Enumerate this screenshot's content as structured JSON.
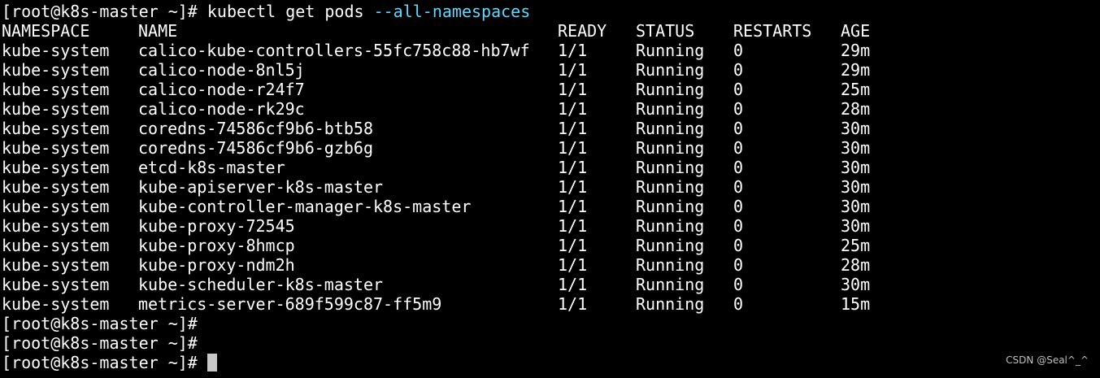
{
  "prompt": "[root@k8s-master ~]#",
  "command": {
    "text": "kubectl get pods",
    "arg": "--all-namespaces"
  },
  "headers": {
    "namespace": "NAMESPACE",
    "name": "NAME",
    "ready": "READY",
    "status": "STATUS",
    "restarts": "RESTARTS",
    "age": "AGE"
  },
  "rows": [
    {
      "namespace": "kube-system",
      "name": "calico-kube-controllers-55fc758c88-hb7wf",
      "ready": "1/1",
      "status": "Running",
      "restarts": "0",
      "age": "29m"
    },
    {
      "namespace": "kube-system",
      "name": "calico-node-8nl5j",
      "ready": "1/1",
      "status": "Running",
      "restarts": "0",
      "age": "29m"
    },
    {
      "namespace": "kube-system",
      "name": "calico-node-r24f7",
      "ready": "1/1",
      "status": "Running",
      "restarts": "0",
      "age": "25m"
    },
    {
      "namespace": "kube-system",
      "name": "calico-node-rk29c",
      "ready": "1/1",
      "status": "Running",
      "restarts": "0",
      "age": "28m"
    },
    {
      "namespace": "kube-system",
      "name": "coredns-74586cf9b6-btb58",
      "ready": "1/1",
      "status": "Running",
      "restarts": "0",
      "age": "30m"
    },
    {
      "namespace": "kube-system",
      "name": "coredns-74586cf9b6-gzb6g",
      "ready": "1/1",
      "status": "Running",
      "restarts": "0",
      "age": "30m"
    },
    {
      "namespace": "kube-system",
      "name": "etcd-k8s-master",
      "ready": "1/1",
      "status": "Running",
      "restarts": "0",
      "age": "30m"
    },
    {
      "namespace": "kube-system",
      "name": "kube-apiserver-k8s-master",
      "ready": "1/1",
      "status": "Running",
      "restarts": "0",
      "age": "30m"
    },
    {
      "namespace": "kube-system",
      "name": "kube-controller-manager-k8s-master",
      "ready": "1/1",
      "status": "Running",
      "restarts": "0",
      "age": "30m"
    },
    {
      "namespace": "kube-system",
      "name": "kube-proxy-72545",
      "ready": "1/1",
      "status": "Running",
      "restarts": "0",
      "age": "30m"
    },
    {
      "namespace": "kube-system",
      "name": "kube-proxy-8hmcp",
      "ready": "1/1",
      "status": "Running",
      "restarts": "0",
      "age": "25m"
    },
    {
      "namespace": "kube-system",
      "name": "kube-proxy-ndm2h",
      "ready": "1/1",
      "status": "Running",
      "restarts": "0",
      "age": "28m"
    },
    {
      "namespace": "kube-system",
      "name": "kube-scheduler-k8s-master",
      "ready": "1/1",
      "status": "Running",
      "restarts": "0",
      "age": "30m"
    },
    {
      "namespace": "kube-system",
      "name": "metrics-server-689f599c87-ff5m9",
      "ready": "1/1",
      "status": "Running",
      "restarts": "0",
      "age": "15m"
    }
  ],
  "trailing_prompts": [
    "[root@k8s-master ~]#",
    "[root@k8s-master ~]#"
  ],
  "final_prompt": "[root@k8s-master ~]#",
  "watermark": "CSDN @Seal^_^",
  "colors": {
    "background": "#000000",
    "foreground": "#ffffff",
    "argument": "#5fd7ff",
    "cursor": "#c8c8c8"
  }
}
